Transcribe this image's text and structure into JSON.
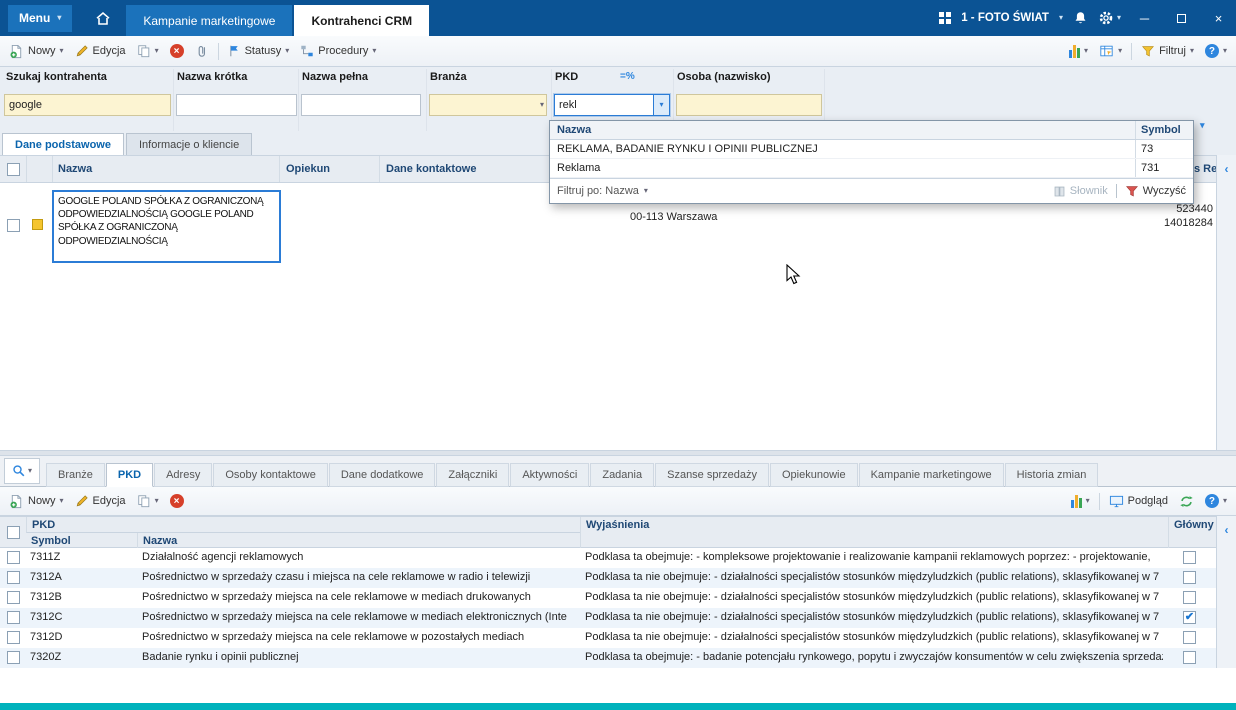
{
  "titlebar": {
    "menu": "Menu",
    "tabs": [
      {
        "label": "Kampanie marketingowe"
      },
      {
        "label": "Kontrahenci CRM"
      }
    ],
    "workspace": "1 - FOTO ŚWIAT",
    "window_controls": {
      "minimize": "─",
      "close": "×"
    }
  },
  "toolbar": {
    "nowy": "Nowy",
    "edycja": "Edycja",
    "statusy": "Statusy",
    "procedury": "Procedury",
    "filtruj": "Filtruj"
  },
  "filters": {
    "search": {
      "label": "Szukaj kontrahenta",
      "value": "google"
    },
    "nazwa_krotka": {
      "label": "Nazwa krótka",
      "value": ""
    },
    "nazwa_pelna": {
      "label": "Nazwa pełna",
      "value": ""
    },
    "branza": {
      "label": "Branża",
      "value": ""
    },
    "pkd": {
      "label": "PKD",
      "value": "rekl",
      "match_icon": "=%"
    },
    "osoba": {
      "label": "Osoba (nazwisko)",
      "value": ""
    }
  },
  "pkd_dropdown": {
    "col_nazwa": "Nazwa",
    "col_symbol": "Symbol",
    "rows": [
      {
        "nazwa": "REKLAMA, BADANIE RYNKU I OPINII PUBLICZNEJ",
        "symbol": "73"
      },
      {
        "nazwa": "Reklama",
        "symbol": "731"
      }
    ],
    "filter_by": "Filtruj po: Nazwa",
    "slownik": "Słownik",
    "wyczysc": "Wyczyść"
  },
  "detail_tabs": [
    {
      "label": "Dane podstawowe"
    },
    {
      "label": "Informacje o kliencie"
    }
  ],
  "main_grid": {
    "col_nazwa": "Nazwa",
    "col_opiekun": "Opiekun",
    "col_dane": "Dane kontaktowe",
    "col_partial": "s Re",
    "row": {
      "nazwa": "GOOGLE POLAND SPÓŁKA Z OGRANICZONĄ ODPOWIEDZIALNOŚCIĄ GOOGLE POLAND SPÓŁKA Z OGRANICZONĄ ODPOWIEDZIALNOŚCIĄ",
      "adres": "00-113 Warszawa",
      "num1": "523440",
      "num2": "14018284"
    }
  },
  "bottom_tabs": [
    {
      "label": "Branże"
    },
    {
      "label": "PKD"
    },
    {
      "label": "Adresy"
    },
    {
      "label": "Osoby kontaktowe"
    },
    {
      "label": "Dane dodatkowe"
    },
    {
      "label": "Załączniki"
    },
    {
      "label": "Aktywności"
    },
    {
      "label": "Zadania"
    },
    {
      "label": "Szanse sprzedaży"
    },
    {
      "label": "Opiekunowie"
    },
    {
      "label": "Kampanie marketingowe"
    },
    {
      "label": "Historia zmian"
    }
  ],
  "bottom_toolbar": {
    "nowy": "Nowy",
    "edycja": "Edycja",
    "podglad": "Podgląd"
  },
  "bottom_grid": {
    "group_pkd": "PKD",
    "col_symbol": "Symbol",
    "col_nazwa": "Nazwa",
    "col_wyjasnienia": "Wyjaśnienia",
    "col_glowny": "Główny",
    "rows": [
      {
        "symbol": "7311Z",
        "nazwa": "Działalność agencji reklamowych",
        "wyjasnienia": "Podklasa ta obejmuje:  - kompleksowe projektowanie i realizowanie kampanii reklamowych poprzez:   - projektowanie, ",
        "glowny": false
      },
      {
        "symbol": "7312A",
        "nazwa": "Pośrednictwo w sprzedaży czasu i miejsca na cele reklamowe w radio i telewizji",
        "wyjasnienia": "Podklasa ta nie obejmuje:  - działalności specjalistów stosunków międzyludzkich (public relations), sklasyfikowanej w 7",
        "glowny": false
      },
      {
        "symbol": "7312B",
        "nazwa": "Pośrednictwo w sprzedaży miejsca na cele reklamowe w mediach drukowanych",
        "wyjasnienia": "Podklasa ta nie obejmuje:  - działalności specjalistów stosunków międzyludzkich (public relations), sklasyfikowanej w 7",
        "glowny": false
      },
      {
        "symbol": "7312C",
        "nazwa": "Pośrednictwo w sprzedaży miejsca na cele reklamowe w mediach elektronicznych (Inte",
        "wyjasnienia": "Podklasa ta nie obejmuje:  - działalności specjalistów stosunków międzyludzkich (public relations), sklasyfikowanej w 7",
        "glowny": true
      },
      {
        "symbol": "7312D",
        "nazwa": "Pośrednictwo w sprzedaży miejsca na cele reklamowe w pozostałych mediach",
        "wyjasnienia": "Podklasa ta nie obejmuje:  - działalności specjalistów stosunków międzyludzkich (public relations), sklasyfikowanej w 7",
        "glowny": false
      },
      {
        "symbol": "7320Z",
        "nazwa": "Badanie rynku i opinii publicznej",
        "wyjasnienia": "Podklasa ta obejmuje:  - badanie potencjału rynkowego, popytu i zwyczajów konsumentów w celu zwiększenia sprzedaż",
        "glowny": false
      }
    ]
  },
  "icons": {
    "chevron_down": "▾",
    "collapse_left": "‹",
    "check": "✔",
    "delete": "×",
    "help": "?"
  },
  "colors": {
    "titlebar": "#0b5394",
    "accent_blue": "#1b72bb",
    "focus_blue": "#2b7cd6",
    "header_text": "#1f4875",
    "input_yellow": "#fcf4d2",
    "teal_strip": "#00b2bc",
    "row_alt": "#edf4fb",
    "selected_indicator_yellow": "#f5c52e"
  }
}
